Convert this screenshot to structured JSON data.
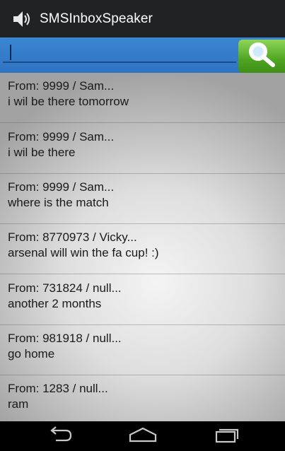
{
  "app": {
    "title": "SMSInboxSpeaker",
    "icon": "speaker-icon"
  },
  "search": {
    "value": "",
    "button_icon": "search-icon"
  },
  "messages": [
    {
      "from": "From:  9999 / Sam...",
      "text": "i wil be there tomorrow"
    },
    {
      "from": "From:  9999 / Sam...",
      "text": "i wil be there"
    },
    {
      "from": "From:  9999 / Sam...",
      "text": "where is the match"
    },
    {
      "from": "From:  8770973 / Vicky...",
      "text": "arsenal will win the fa cup! :)"
    },
    {
      "from": "From:  731824 / null...",
      "text": "another 2 months"
    },
    {
      "from": "From:  981918 / null...",
      "text": "go home"
    },
    {
      "from": "From:  1283 / null...",
      "text": "ram"
    }
  ],
  "nav": {
    "back": "back-icon",
    "home": "home-icon",
    "recents": "recents-icon"
  },
  "colors": {
    "action_bar": "#202224",
    "search_bar": "#3a86d2",
    "search_button": "#4fa521"
  }
}
